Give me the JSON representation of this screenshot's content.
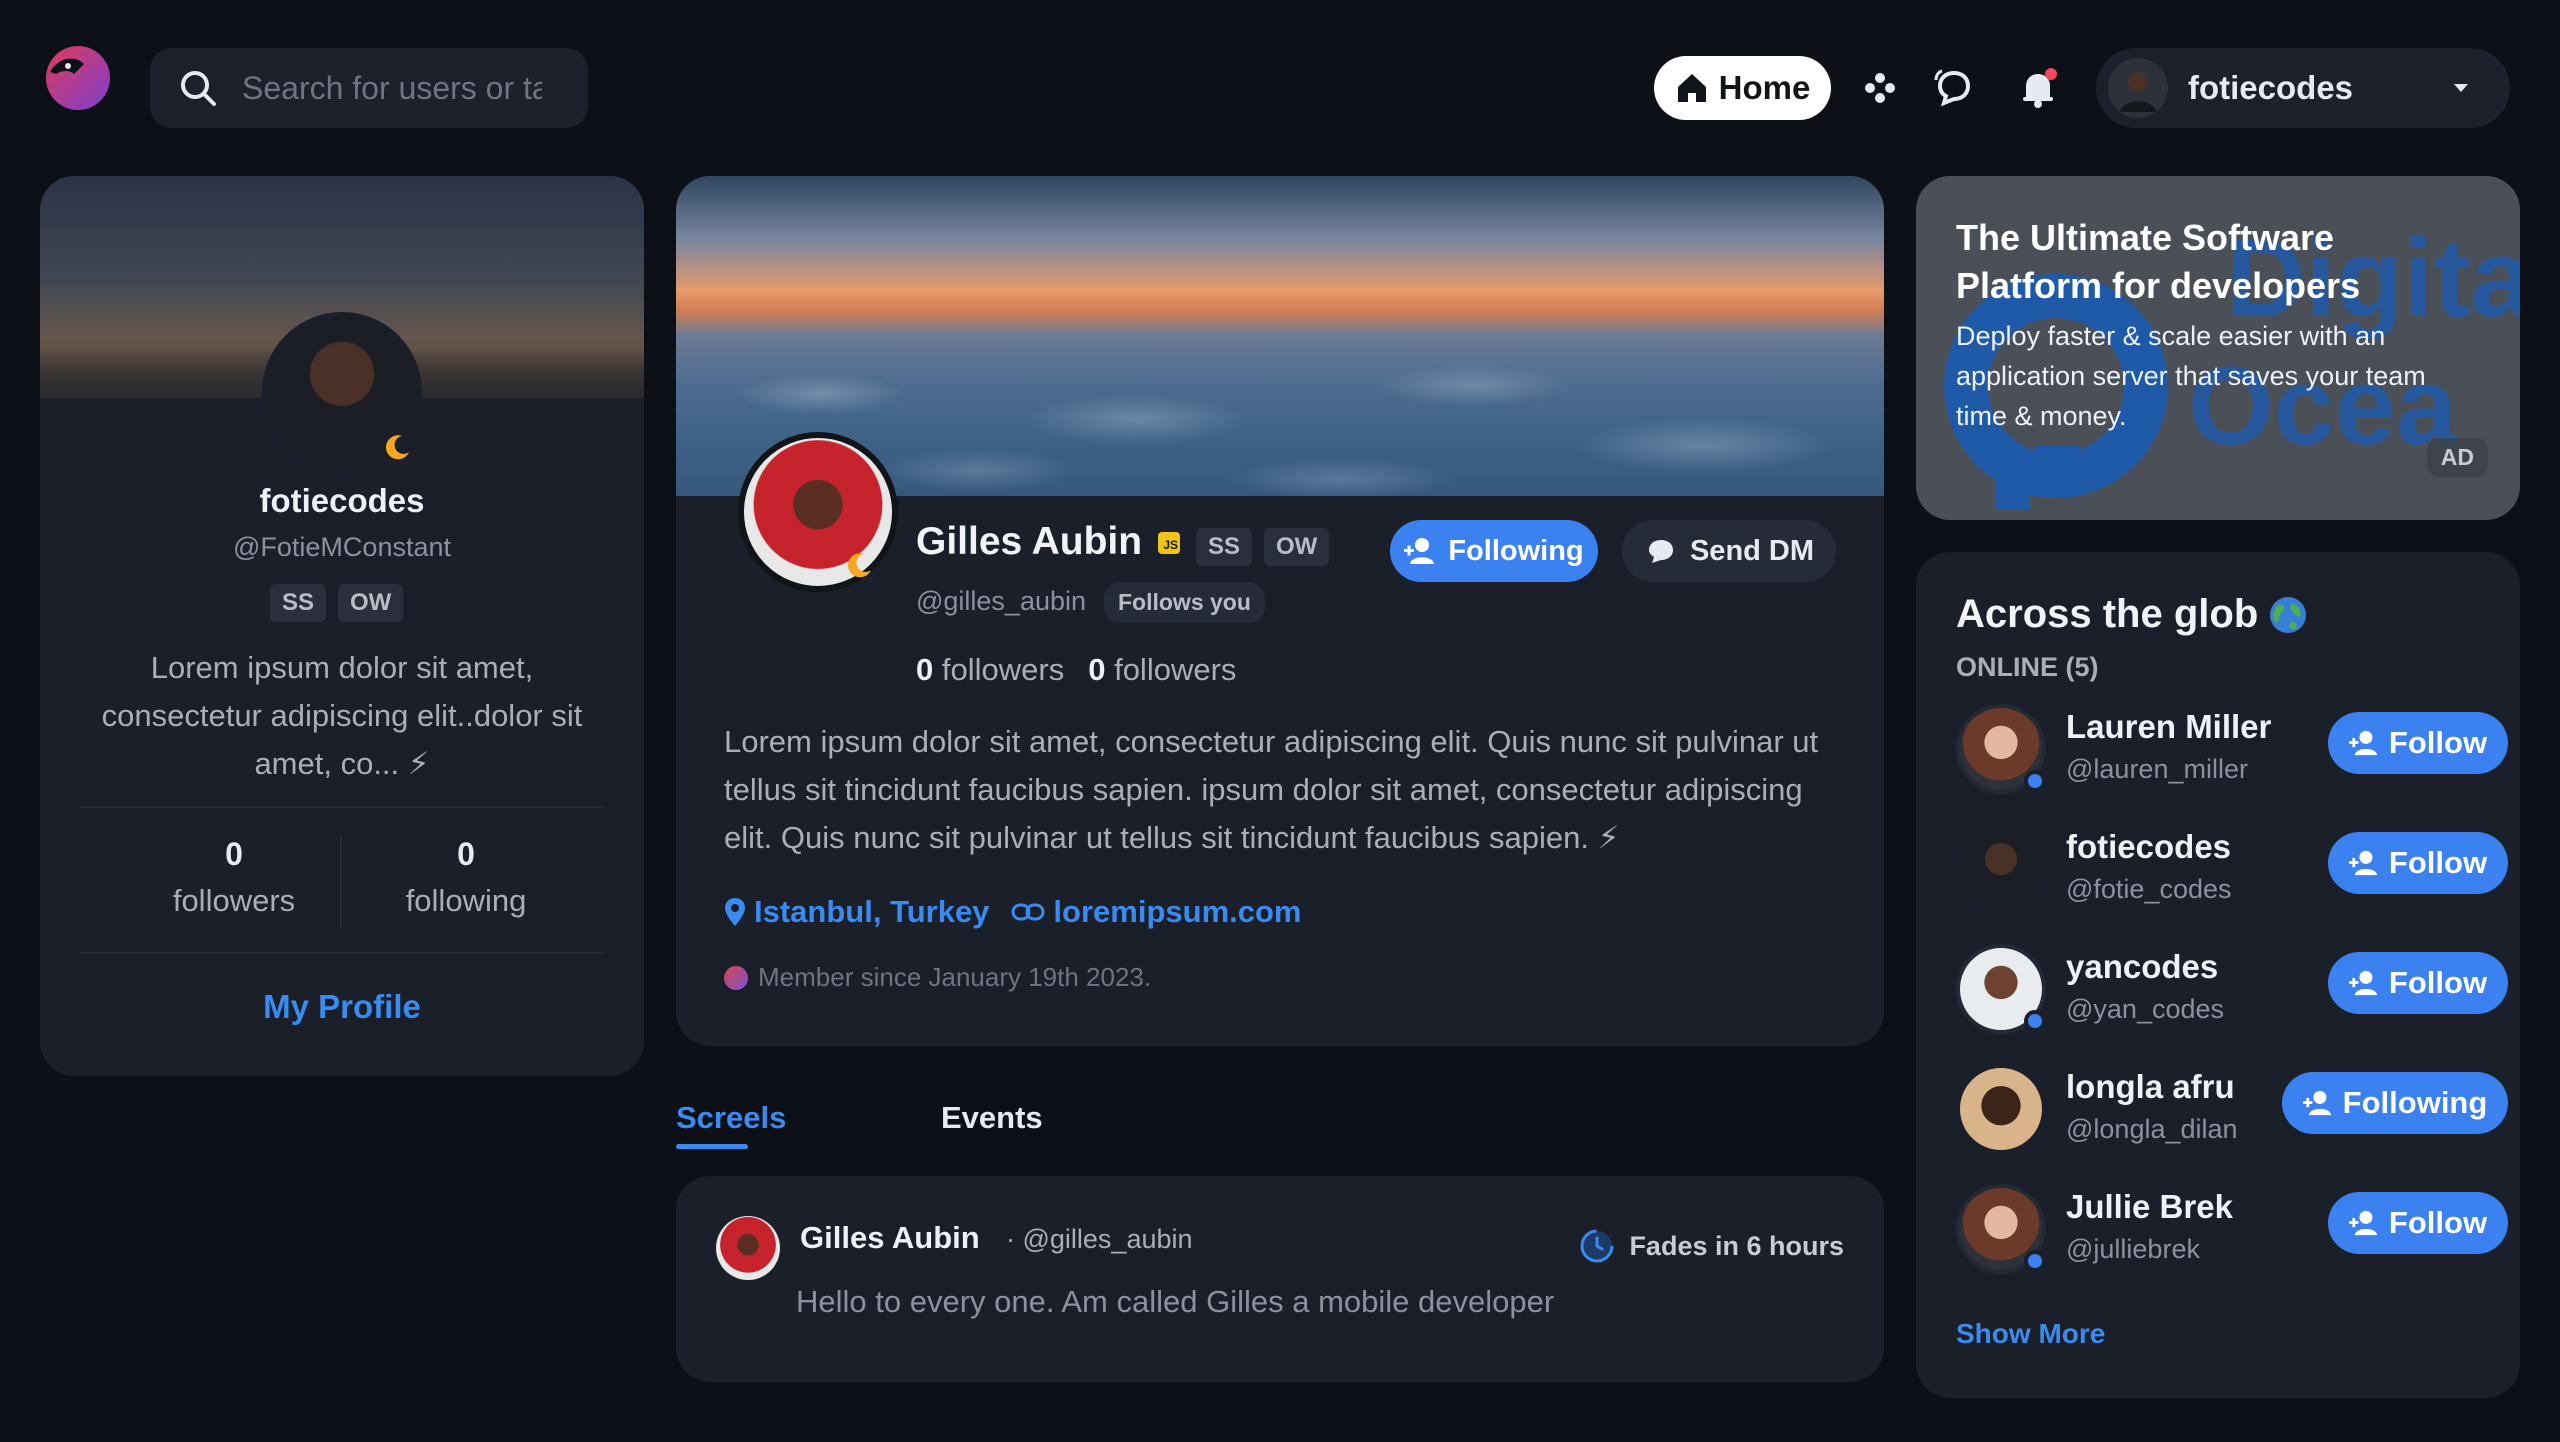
{
  "topbar": {
    "search_placeholder": "Search for users or ta",
    "home_label": "Home",
    "username": "fotiecodes"
  },
  "left_profile": {
    "name": "fotiecodes",
    "handle": "@FotieMConstant",
    "tags": [
      "SS",
      "OW"
    ],
    "bio": "Lorem ipsum dolor sit amet, consectetur adipiscing elit..dolor sit amet, co... ⚡",
    "followers_count": "0",
    "followers_label": "followers",
    "following_count": "0",
    "following_label": "following",
    "my_profile_label": "My Profile"
  },
  "profile": {
    "name": "Gilles Aubin",
    "js_badge": "JS",
    "tags": [
      "SS",
      "OW"
    ],
    "handle": "@gilles_aubin",
    "follows_you": "Follows you",
    "following_label": "Following",
    "dm_label": "Send DM",
    "stat1_count": "0",
    "stat1_label": "followers",
    "stat2_count": "0",
    "stat2_label": "followers",
    "bio": "Lorem ipsum dolor sit amet, consectetur adipiscing elit. Quis nunc sit pulvinar ut tellus sit tincidunt faucibus sapien. ipsum dolor sit amet, consectetur adipiscing elit. Quis nunc sit pulvinar ut tellus sit tincidunt faucibus sapien. ⚡",
    "location": "Istanbul, Turkey",
    "website": "loremipsum.com",
    "member_since": "Member since January 19th 2023."
  },
  "tabs": [
    {
      "label": "Screels",
      "active": true
    },
    {
      "label": "Events",
      "active": false
    }
  ],
  "post": {
    "name": "Gilles Aubin",
    "handle": "· @gilles_aubin",
    "fade_label": "Fades in 6 hours",
    "text": "Hello to every one. Am called Gilles a mobile developer"
  },
  "ad": {
    "title": "The Ultimate Software Platform for developers",
    "text": "Deploy faster & scale easier with an application server that saves your team time & money.",
    "badge": "AD",
    "bg_brand_text": "Digital Ocean"
  },
  "glob": {
    "title": "Across the glob",
    "online_label": "ONLINE (5)",
    "users": [
      {
        "name": "Lauren Miller",
        "handle": "@lauren_miller",
        "button": "Follow",
        "online": true
      },
      {
        "name": "fotiecodes",
        "handle": "@fotie_codes",
        "button": "Follow",
        "online": false
      },
      {
        "name": "yancodes",
        "handle": "@yan_codes",
        "button": "Follow",
        "online": true
      },
      {
        "name": "longla afru",
        "handle": "@longla_dilan",
        "button": "Following",
        "online": false
      },
      {
        "name": "Jullie Brek",
        "handle": "@julliebrek",
        "button": "Follow",
        "online": true
      }
    ],
    "show_more": "Show More"
  },
  "colors": {
    "background": "#0d1017",
    "card": "#1a1f29",
    "accent": "#3b82f0",
    "moon": "#f5a623"
  }
}
